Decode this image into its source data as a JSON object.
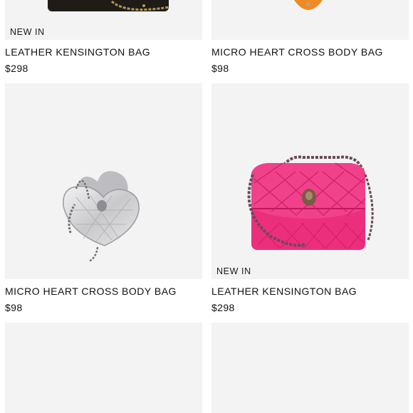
{
  "products": [
    {
      "badge": "NEW IN",
      "name": "LEATHER KENSINGTON BAG",
      "price": "$298",
      "image": "black-quilted-bag",
      "colors": {
        "bag": "#1f1c18",
        "chain": "#b79a4f"
      }
    },
    {
      "badge": "",
      "name": "MICRO HEART CROSS BODY BAG",
      "price": "$98",
      "image": "orange-heart-bag",
      "colors": {
        "bag": "#ef8a26"
      }
    },
    {
      "badge": "",
      "name": "MICRO HEART CROSS BODY BAG",
      "price": "$98",
      "image": "silver-heart-bag",
      "colors": {
        "bag": "#d9d9db",
        "chain": "#6d6d6d"
      }
    },
    {
      "badge": "NEW IN",
      "name": "LEATHER KENSINGTON BAG",
      "price": "$298",
      "image": "pink-quilted-bag",
      "colors": {
        "bag": "#ec2f7c",
        "chain": "#6b4a58",
        "hardware": "#7a5b45"
      }
    },
    {
      "image": "loading-placeholder"
    },
    {
      "image": "loading-placeholder"
    }
  ],
  "colors": {
    "card_bg": "#f3f3f3",
    "text": "#111111"
  }
}
